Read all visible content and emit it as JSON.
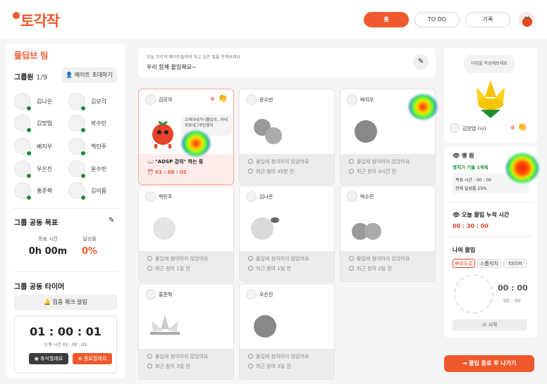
{
  "header": {
    "logo": "토각작",
    "nav": [
      "홈",
      "TO DO",
      "기록"
    ],
    "active": 0
  },
  "sidebar": {
    "title": "몰딥브 팀",
    "members_label": "그룹원",
    "members_count": "1/9",
    "invite": "메이트 초대하기",
    "members": [
      "김나은",
      "김모각",
      "김맛업",
      "박수민",
      "배지우",
      "백민주",
      "우은진",
      "윤수빈",
      "홍준혁",
      "김이름"
    ],
    "goal_title": "그룹 공동 목표",
    "goal_time_label": "목표 시간",
    "goal_time": "0h 00m",
    "goal_rate_label": "달성률",
    "goal_rate": "0%",
    "timer_title": "그룹 공동 타이머",
    "alarm": "집중 체크 알림",
    "timer": "01 : 00 : 01",
    "timer_total": "누적 시간  01 : 00 : 01",
    "rest_btn": "휴식할래요",
    "end_btn": "종료할래요"
  },
  "center": {
    "prompt": "오늘 모각작 메이트들에게 하고 싶은 말을 전해보세요",
    "message": "우리 함께 몰입해요~"
  },
  "cards": [
    {
      "name": "김모각",
      "count": "0",
      "bubble": "오케이네가니몰입이...아네포와네그루빈했지",
      "status": "\"ADSP 강의\" 하는 중",
      "time": "01 : 00 : 02"
    },
    {
      "name": "윤수빈",
      "status": "몰입에 참여하지 않았어요",
      "time": "최근 참여 45분 전"
    },
    {
      "name": "배지우",
      "status": "몰입에 참여하지 않았어요",
      "time": "최근 참여 3시간 전"
    },
    {
      "name": "백민주",
      "status": "몰입에 참여하지 않았어요",
      "time": "최근 참여 1일 전"
    },
    {
      "name": "김나은",
      "status": "몰입에 참여하지 않았어요",
      "time": "최근 참여 1일 전"
    },
    {
      "name": "박수민",
      "status": "몰입에 참여하지 않았어요",
      "time": "최근 참여 2일 전"
    },
    {
      "name": "홍준혁",
      "status": "몰입에 참여하지 않았어요",
      "time": "최근 참여 3일 전"
    },
    {
      "name": "우은진",
      "status": "몰입에 참여하지 않았어요",
      "time": "최근 참여 3일 전"
    }
  ],
  "right": {
    "bubble": "다짐을 작성해보세요",
    "me": "김맛업 (나)",
    "count": "0",
    "rank_title": "랭 원",
    "rank_sub": "경치기 기술 1위독",
    "goal_time": "목표 시간 : 00 : 00",
    "goal_rate": "전체 달성률  25%",
    "today_title": "오늘 몰입 누적 시간",
    "today_time": "00 : 30 : 00",
    "my_title": "나의 몰입",
    "tabs": [
      "뽀모도로",
      "스톱워치",
      "타이머"
    ],
    "clock": "00 : 00",
    "clock2": "00 : 00",
    "start": "시작",
    "exit": "몰입 종료 후 나가기"
  },
  "colors": {
    "accent": "#f0592d",
    "green": "#1f8a34"
  }
}
